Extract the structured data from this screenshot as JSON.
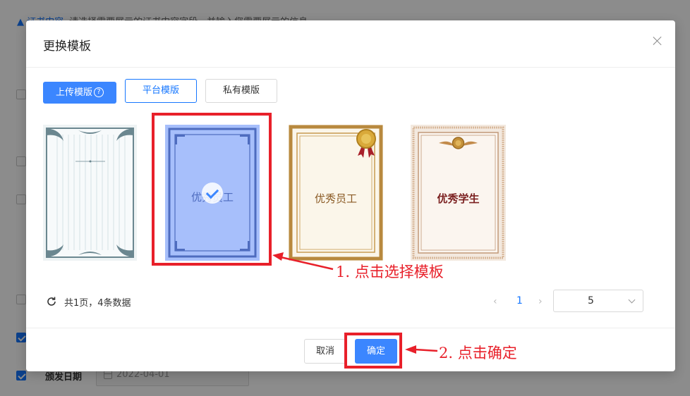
{
  "background": {
    "section_title": "证书内容",
    "section_desc": "请选择需要展示的证书内容字段，并输入您需要展示的信息",
    "issue_date_label": "颁发日期",
    "issue_date_value": "2022-04-01"
  },
  "modal": {
    "title": "更换模板",
    "tabs": {
      "upload": "上传模版",
      "upload_help": "?",
      "platform": "平台模版",
      "private": "私有模版"
    },
    "templates": [
      {
        "title": "",
        "selected": false
      },
      {
        "title": "优秀员工",
        "selected": true
      },
      {
        "title": "优秀员工",
        "selected": false
      },
      {
        "title": "优秀学生",
        "selected": false
      }
    ],
    "total_text": "共1页，4条数据",
    "pagination": {
      "prev": "‹",
      "current": "1",
      "next": "›",
      "page_size": "5"
    },
    "cancel_label": "取消",
    "ok_label": "确定"
  },
  "annotations": {
    "step1": "1. 点击选择模板",
    "step2": "2. 点击确定",
    "color": "#e8202a"
  },
  "colors": {
    "primary": "#3b86ff",
    "link": "#1677ff"
  }
}
